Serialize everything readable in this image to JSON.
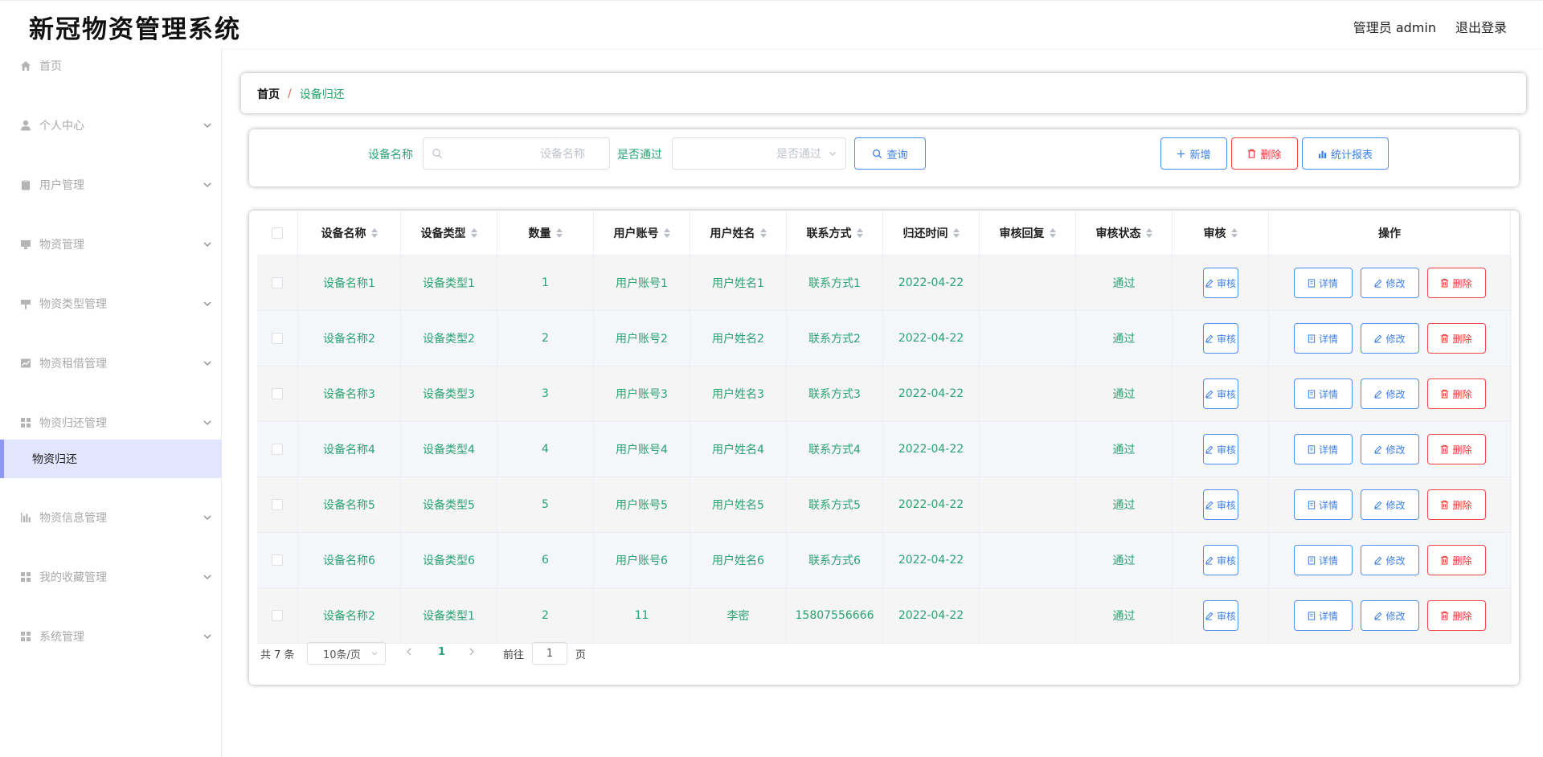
{
  "header": {
    "title": "新冠物资管理系统",
    "user_label": "管理员 admin",
    "logout_label": "退出登录"
  },
  "sidebar": {
    "items": [
      {
        "label": "首页",
        "icon": "home-icon",
        "has_children": false
      },
      {
        "label": "个人中心",
        "icon": "user-icon",
        "has_children": true
      },
      {
        "label": "用户管理",
        "icon": "clipboard-icon",
        "has_children": true
      },
      {
        "label": "物资管理",
        "icon": "monitor-icon",
        "has_children": true
      },
      {
        "label": "物资类型管理",
        "icon": "sign-icon",
        "has_children": true
      },
      {
        "label": "物资租借管理",
        "icon": "chart-icon",
        "has_children": true
      },
      {
        "label": "物资归还管理",
        "icon": "grid-icon",
        "has_children": true,
        "expanded": true
      },
      {
        "label": "物资信息管理",
        "icon": "bar-chart-icon",
        "has_children": true
      },
      {
        "label": "我的收藏管理",
        "icon": "grid-icon",
        "has_children": true
      },
      {
        "label": "系统管理",
        "icon": "grid-icon",
        "has_children": true
      }
    ],
    "active_subitem": "物资归还"
  },
  "breadcrumb": {
    "home": "首页",
    "separator": "/",
    "current": "设备归还"
  },
  "search": {
    "name_label": "设备名称",
    "name_placeholder": "设备名称",
    "pass_label": "是否通过",
    "pass_placeholder": "是否通过",
    "query_label": "查询",
    "add_label": "新增",
    "delete_label": "删除",
    "report_label": "统计报表"
  },
  "table": {
    "columns": [
      "设备名称",
      "设备类型",
      "数量",
      "用户账号",
      "用户姓名",
      "联系方式",
      "归还时间",
      "审核回复",
      "审核状态",
      "审核",
      "操作"
    ],
    "rows": [
      {
        "name": "设备名称1",
        "type": "设备类型1",
        "qty": "1",
        "account": "用户账号1",
        "username": "用户姓名1",
        "contact": "联系方式1",
        "time": "2022-04-22",
        "reply": "",
        "status": "通过"
      },
      {
        "name": "设备名称2",
        "type": "设备类型2",
        "qty": "2",
        "account": "用户账号2",
        "username": "用户姓名2",
        "contact": "联系方式2",
        "time": "2022-04-22",
        "reply": "",
        "status": "通过"
      },
      {
        "name": "设备名称3",
        "type": "设备类型3",
        "qty": "3",
        "account": "用户账号3",
        "username": "用户姓名3",
        "contact": "联系方式3",
        "time": "2022-04-22",
        "reply": "",
        "status": "通过"
      },
      {
        "name": "设备名称4",
        "type": "设备类型4",
        "qty": "4",
        "account": "用户账号4",
        "username": "用户姓名4",
        "contact": "联系方式4",
        "time": "2022-04-22",
        "reply": "",
        "status": "通过"
      },
      {
        "name": "设备名称5",
        "type": "设备类型5",
        "qty": "5",
        "account": "用户账号5",
        "username": "用户姓名5",
        "contact": "联系方式5",
        "time": "2022-04-22",
        "reply": "",
        "status": "通过"
      },
      {
        "name": "设备名称6",
        "type": "设备类型6",
        "qty": "6",
        "account": "用户账号6",
        "username": "用户姓名6",
        "contact": "联系方式6",
        "time": "2022-04-22",
        "reply": "",
        "status": "通过"
      },
      {
        "name": "设备名称2",
        "type": "设备类型1",
        "qty": "2",
        "account": "11",
        "username": "李密",
        "contact": "15807556666",
        "time": "2022-04-22",
        "reply": "",
        "status": "通过"
      }
    ],
    "audit_label": "审核",
    "detail_label": "详情",
    "edit_label": "修改",
    "delete_label": "删除"
  },
  "pagination": {
    "total": "共 7 条",
    "page_size": "10条/页",
    "current_page": "1",
    "goto_prefix": "前往",
    "goto_value": "1",
    "goto_suffix": "页"
  },
  "colors": {
    "accent_green": "#2aa274",
    "primary_blue": "#3c7fe8",
    "danger_red": "#e33333",
    "active_menu_bg": "#e2e5ff"
  }
}
